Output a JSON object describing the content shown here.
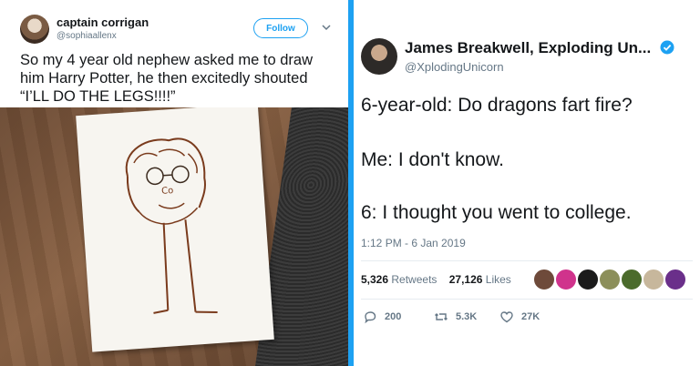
{
  "left_tweet": {
    "name": "captain corrigan",
    "handle": "@sophiaallenx",
    "follow_label": "Follow",
    "text": "So my 4 year old nephew asked me to draw him Harry Potter, he then excitedly shouted “I’LL DO THE LEGS!!!!”",
    "photo_text": "Co"
  },
  "right_tweet": {
    "name": "James Breakwell, Exploding Un...",
    "handle": "@XplodingUnicorn",
    "lines": [
      "6-year-old: Do dragons fart fire?",
      "Me: I don't know.",
      "6: I thought you went to college."
    ],
    "timestamp": "1:12 PM - 6 Jan 2019",
    "retweets_count": "5,326",
    "retweets_label": "Retweets",
    "likes_count": "27,126",
    "likes_label": "Likes",
    "replies": "200",
    "retweet_action": "5.3K",
    "like_action": "27K"
  },
  "colors": {
    "accent": "#1da1f2",
    "text": "#14171a",
    "muted": "#657786"
  }
}
